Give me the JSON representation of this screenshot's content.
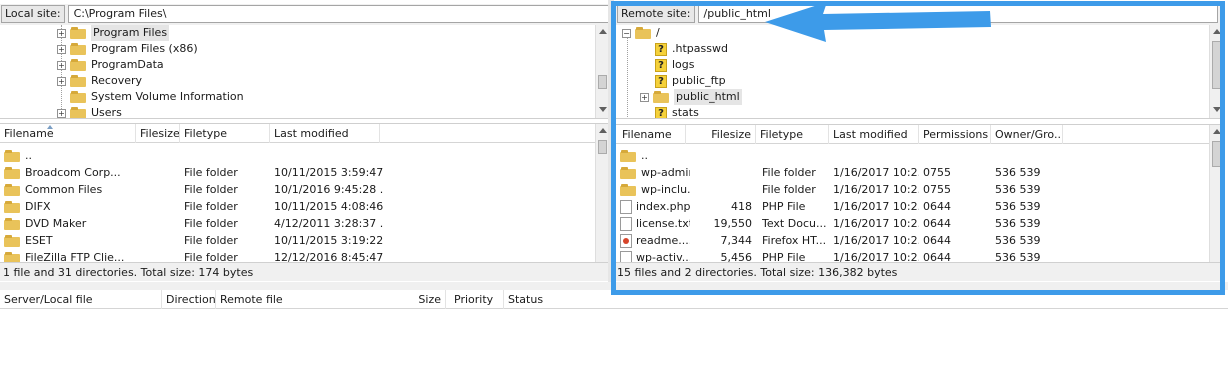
{
  "local": {
    "site_label": "Local site:",
    "site_path": "C:\\Program Files\\",
    "tree": [
      "Program Files",
      "Program Files (x86)",
      "ProgramData",
      "Recovery",
      "System Volume Information",
      "Users"
    ],
    "columns": [
      "Filename",
      "Filesize",
      "Filetype",
      "Last modified"
    ],
    "files": [
      {
        "name": "..",
        "size": "",
        "type": "",
        "modified": ""
      },
      {
        "name": "Broadcom Corp...",
        "size": "",
        "type": "File folder",
        "modified": "10/11/2015 3:59:47..."
      },
      {
        "name": "Common Files",
        "size": "",
        "type": "File folder",
        "modified": "10/1/2016 9:45:28 ..."
      },
      {
        "name": "DIFX",
        "size": "",
        "type": "File folder",
        "modified": "10/11/2015 4:08:46..."
      },
      {
        "name": "DVD Maker",
        "size": "",
        "type": "File folder",
        "modified": "4/12/2011 3:28:37 ..."
      },
      {
        "name": "ESET",
        "size": "",
        "type": "File folder",
        "modified": "10/11/2015 3:19:22..."
      },
      {
        "name": "FileZilla FTP Clie...",
        "size": "",
        "type": "File folder",
        "modified": "12/12/2016 8:45:47..."
      }
    ],
    "status": "1 file and 31 directories. Total size: 174 bytes"
  },
  "remote": {
    "site_label": "Remote site:",
    "site_path": "/public_html",
    "tree": [
      {
        "label": "/",
        "kind": "folder",
        "expander": "−"
      },
      {
        "label": ".htpasswd",
        "kind": "unknown",
        "expander": ""
      },
      {
        "label": "logs",
        "kind": "unknown",
        "expander": ""
      },
      {
        "label": "public_ftp",
        "kind": "unknown",
        "expander": ""
      },
      {
        "label": "public_html",
        "kind": "folder",
        "expander": "+"
      },
      {
        "label": "stats",
        "kind": "unknown",
        "expander": ""
      }
    ],
    "columns": [
      "Filename",
      "Filesize",
      "Filetype",
      "Last modified",
      "Permissions",
      "Owner/Gro..."
    ],
    "files": [
      {
        "name": "..",
        "size": "",
        "type": "",
        "modified": "",
        "perm": "",
        "owner": "",
        "icon": "folder"
      },
      {
        "name": "wp-admin",
        "size": "",
        "type": "File folder",
        "modified": "1/16/2017 10:2...",
        "perm": "0755",
        "owner": "536 539",
        "icon": "folder"
      },
      {
        "name": "wp-inclu...",
        "size": "",
        "type": "File folder",
        "modified": "1/16/2017 10:2...",
        "perm": "0755",
        "owner": "536 539",
        "icon": "folder"
      },
      {
        "name": "index.php",
        "size": "418",
        "type": "PHP File",
        "modified": "1/16/2017 10:2...",
        "perm": "0644",
        "owner": "536 539",
        "icon": "file"
      },
      {
        "name": "license.txt",
        "size": "19,550",
        "type": "Text Docu...",
        "modified": "1/16/2017 10:2...",
        "perm": "0644",
        "owner": "536 539",
        "icon": "file"
      },
      {
        "name": "readme....",
        "size": "7,344",
        "type": "Firefox HT...",
        "modified": "1/16/2017 10:2...",
        "perm": "0644",
        "owner": "536 539",
        "icon": "firefox"
      },
      {
        "name": "wp-activ...",
        "size": "5,456",
        "type": "PHP File",
        "modified": "1/16/2017 10:2...",
        "perm": "0644",
        "owner": "536 539",
        "icon": "file"
      }
    ],
    "status": "15 files and 2 directories. Total size: 136,382 bytes"
  },
  "queue": {
    "columns": [
      "Server/Local file",
      "Direction",
      "Remote file",
      "Size",
      "Priority",
      "Status"
    ]
  },
  "colors": {
    "highlight": "#3d9be9",
    "folder": "#e9c35a"
  }
}
